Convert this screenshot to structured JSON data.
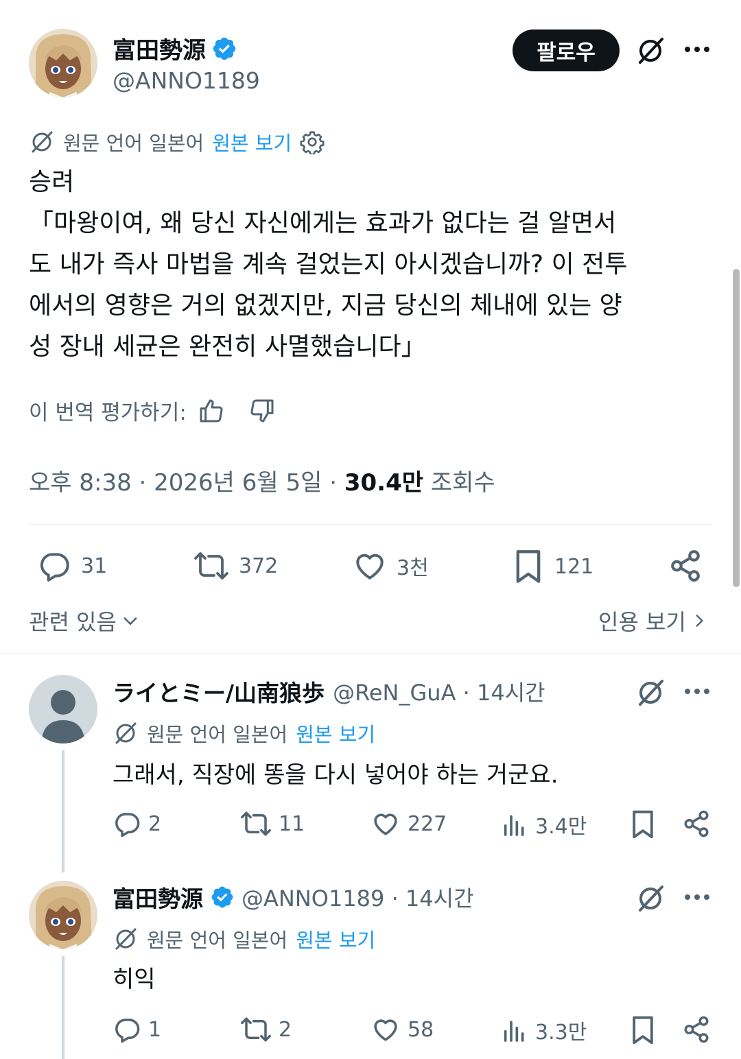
{
  "author": {
    "name": "富田勢源",
    "handle": "@ANNO1189",
    "verified": true
  },
  "header": {
    "follow_label": "팔로우",
    "grok_icon": "grok-icon",
    "more_icon": "more-icon"
  },
  "translation": {
    "label": "원문 언어 일본어",
    "link": "원본 보기",
    "settings_icon": "gear-icon"
  },
  "tweet": {
    "text": "승려\n「마왕이여, 왜 당신 자신에게는 효과가 없다는 걸 알면서\n도 내가 즉사 마법을 계속 걸었는지 아시겠습니까? 이 전투\n에서의 영향은 거의 없겠지만, 지금 당신의 체내에 있는 양\n성 장내 세균은 완전히 사멸했습니다」"
  },
  "rating": {
    "label": "이 번역 평가하기:",
    "thumbs_up_icon": "thumbs-up-icon",
    "thumbs_down_icon": "thumbs-down-icon"
  },
  "meta": {
    "time": "오후 8:38",
    "sep1": "·",
    "date": "2026년 6월 5일",
    "sep2": "·",
    "views_count": "30.4만",
    "views_label": "조회수"
  },
  "actions": {
    "replies": "31",
    "reposts": "372",
    "likes": "3천",
    "bookmarks": "121"
  },
  "related": {
    "label": "관련 있음",
    "quotes_label": "인용 보기"
  },
  "replies": [
    {
      "name": "ライとミー/山南狼歩",
      "handle_time": "@ReN_GuA · 14시간",
      "translation_label": "원문 언어 일본어",
      "translation_link": "원본 보기",
      "text": "그래서, 직장에 똥을 다시 넣어야 하는 거군요.",
      "replies": "2",
      "reposts": "11",
      "likes": "227",
      "views": "3.4만"
    },
    {
      "name": "富田勢源",
      "handle_time": "@ANNO1189 · 14시간",
      "translation_label": "원문 언어 일본어",
      "translation_link": "원본 보기",
      "text": "히익",
      "replies": "1",
      "reposts": "2",
      "likes": "58",
      "views": "3.3만"
    }
  ],
  "colors": {
    "accent": "#1d9bf0",
    "text": "#0f1419",
    "muted": "#536471",
    "verified": "#1d9bf0"
  }
}
